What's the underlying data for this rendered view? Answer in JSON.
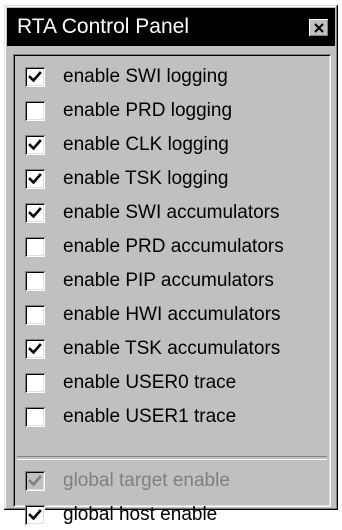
{
  "window": {
    "title": "RTA Control Panel",
    "close_icon": "close-icon"
  },
  "options": [
    {
      "label": "enable SWI logging",
      "checked": true
    },
    {
      "label": "enable PRD logging",
      "checked": false
    },
    {
      "label": "enable CLK logging",
      "checked": true
    },
    {
      "label": "enable TSK logging",
      "checked": true
    },
    {
      "label": "enable SWI accumulators",
      "checked": true
    },
    {
      "label": "enable PRD accumulators",
      "checked": false
    },
    {
      "label": "enable PIP accumulators",
      "checked": false
    },
    {
      "label": "enable HWI accumulators",
      "checked": false
    },
    {
      "label": "enable TSK accumulators",
      "checked": true
    },
    {
      "label": "enable USER0 trace",
      "checked": false
    },
    {
      "label": "enable USER1 trace",
      "checked": false
    }
  ],
  "global": [
    {
      "label": "global target enable",
      "checked": true,
      "disabled": true
    },
    {
      "label": "global host enable",
      "checked": true,
      "disabled": false
    }
  ],
  "colors": {
    "face": "#c0c0c0",
    "titlebar": "#000000",
    "title_text": "#ffffff",
    "disabled_text": "#808080"
  }
}
